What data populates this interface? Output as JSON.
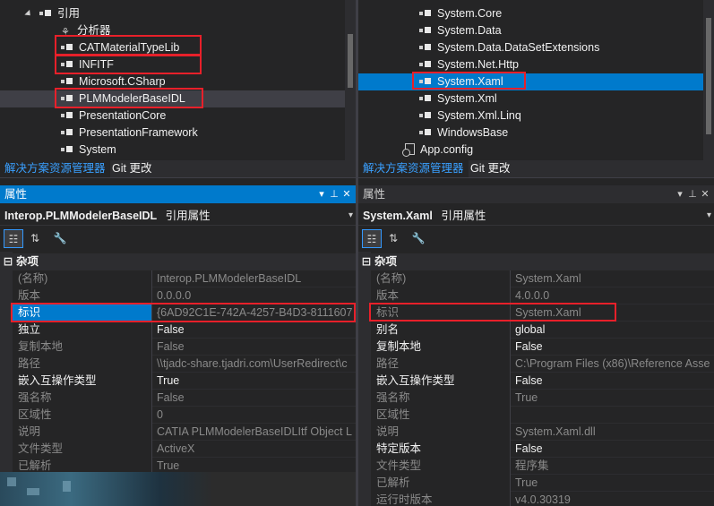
{
  "left": {
    "tree": {
      "rows": [
        {
          "label": "引用",
          "kind": "folder"
        },
        {
          "label": "分析器",
          "kind": "analyzer"
        },
        {
          "label": "CATMaterialTypeLib",
          "kind": "ref"
        },
        {
          "label": "INFITF",
          "kind": "ref"
        },
        {
          "label": "Microsoft.CSharp",
          "kind": "ref"
        },
        {
          "label": "PLMModelerBaseIDL",
          "kind": "ref"
        },
        {
          "label": "PresentationCore",
          "kind": "ref"
        },
        {
          "label": "PresentationFramework",
          "kind": "ref"
        },
        {
          "label": "System",
          "kind": "ref"
        }
      ]
    },
    "tabs": [
      "解决方案资源管理器",
      "Git 更改"
    ],
    "properties": {
      "title": "属性",
      "object_name": "Interop.PLMModelerBaseIDL",
      "object_type": "引用属性",
      "category": "杂项",
      "rows": [
        {
          "name": "(名称)",
          "value": "Interop.PLMModelerBaseIDL",
          "dim": true
        },
        {
          "name": "版本",
          "value": "0.0.0.0",
          "dim": true
        },
        {
          "name": "标识",
          "value": "{6AD92C1E-742A-4257-B4D3-8111607",
          "dim": false
        },
        {
          "name": "独立",
          "value": "False",
          "dim": false
        },
        {
          "name": "复制本地",
          "value": "False",
          "dim": true
        },
        {
          "name": "路径",
          "value": "\\\\tjadc-share.tjadri.com\\UserRedirect\\c",
          "dim": true
        },
        {
          "name": "嵌入互操作类型",
          "value": "True",
          "dim": false
        },
        {
          "name": "强名称",
          "value": "False",
          "dim": true
        },
        {
          "name": "区域性",
          "value": "0",
          "dim": true
        },
        {
          "name": "说明",
          "value": "CATIA PLMModelerBaseIDLItf Object L",
          "dim": true
        },
        {
          "name": "文件类型",
          "value": "ActiveX",
          "dim": true
        },
        {
          "name": "已解析",
          "value": "True",
          "dim": true
        }
      ]
    }
  },
  "right": {
    "tree": {
      "rows": [
        {
          "label": "System.Core",
          "kind": "ref"
        },
        {
          "label": "System.Data",
          "kind": "ref"
        },
        {
          "label": "System.Data.DataSetExtensions",
          "kind": "ref"
        },
        {
          "label": "System.Net.Http",
          "kind": "ref"
        },
        {
          "label": "System.Xaml",
          "kind": "ref"
        },
        {
          "label": "System.Xml",
          "kind": "ref"
        },
        {
          "label": "System.Xml.Linq",
          "kind": "ref"
        },
        {
          "label": "WindowsBase",
          "kind": "ref"
        },
        {
          "label": "App.config",
          "kind": "file"
        }
      ]
    },
    "tabs": [
      "解决方案资源管理器",
      "Git 更改"
    ],
    "properties": {
      "title": "属性",
      "object_name": "System.Xaml",
      "object_type": "引用属性",
      "category": "杂项",
      "rows": [
        {
          "name": "(名称)",
          "value": "System.Xaml",
          "dim": true
        },
        {
          "name": "版本",
          "value": "4.0.0.0",
          "dim": true
        },
        {
          "name": "标识",
          "value": "System.Xaml",
          "dim": true
        },
        {
          "name": "别名",
          "value": "global",
          "dim": false
        },
        {
          "name": "复制本地",
          "value": "False",
          "dim": false
        },
        {
          "name": "路径",
          "value": "C:\\Program Files (x86)\\Reference Asse",
          "dim": true
        },
        {
          "name": "嵌入互操作类型",
          "value": "False",
          "dim": false
        },
        {
          "name": "强名称",
          "value": "True",
          "dim": true
        },
        {
          "name": "区域性",
          "value": "",
          "dim": true
        },
        {
          "name": "说明",
          "value": "System.Xaml.dll",
          "dim": true
        },
        {
          "name": "特定版本",
          "value": "False",
          "dim": false
        },
        {
          "name": "文件类型",
          "value": "程序集",
          "dim": true
        },
        {
          "name": "已解析",
          "value": "True",
          "dim": true
        },
        {
          "name": "运行时版本",
          "value": "v4.0.30319",
          "dim": true
        }
      ]
    }
  },
  "colors": {
    "accent": "#007acc",
    "highlight_box": "#e8202a",
    "background": "#252526"
  }
}
